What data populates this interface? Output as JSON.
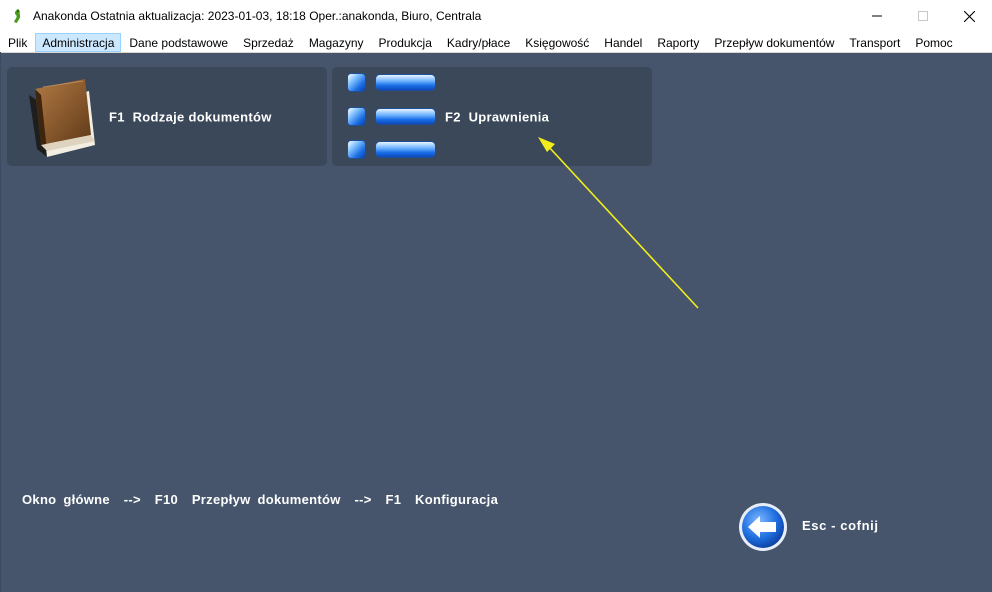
{
  "window": {
    "title": "Anakonda Ostatnia aktualizacja: 2023-01-03, 18:18 Oper.:anakonda, Biuro, Centrala",
    "app_icon": "anakonda-icon",
    "controls": {
      "minimize": "minimize-icon",
      "maximize": "maximize-icon",
      "close": "close-icon"
    }
  },
  "menu": {
    "items": [
      {
        "label": "Plik"
      },
      {
        "label": "Administracja",
        "active": true
      },
      {
        "label": "Dane podstawowe"
      },
      {
        "label": "Sprzedaż"
      },
      {
        "label": "Magazyny"
      },
      {
        "label": "Produkcja"
      },
      {
        "label": "Kadry/płace"
      },
      {
        "label": "Księgowość"
      },
      {
        "label": "Handel"
      },
      {
        "label": "Raporty"
      },
      {
        "label": "Przepływ dokumentów"
      },
      {
        "label": "Transport"
      },
      {
        "label": "Pomoc"
      }
    ]
  },
  "tiles": [
    {
      "label": "F1  Rodzaje dokumentów",
      "icon": "book-icon"
    },
    {
      "label": "F2  Uprawnienia",
      "icon": "permissions-icon"
    }
  ],
  "breadcrumb": "Okno główne  -->  F10  Przepływ dokumentów  -->  F1  Konfiguracja",
  "back": {
    "label": "Esc - cofnij",
    "icon": "back-arrow-icon"
  },
  "colors": {
    "background": "#46556b",
    "tile": "#3a4859",
    "menu_active": "#cce8ff",
    "annotation_arrow": "#f2ee1c"
  }
}
